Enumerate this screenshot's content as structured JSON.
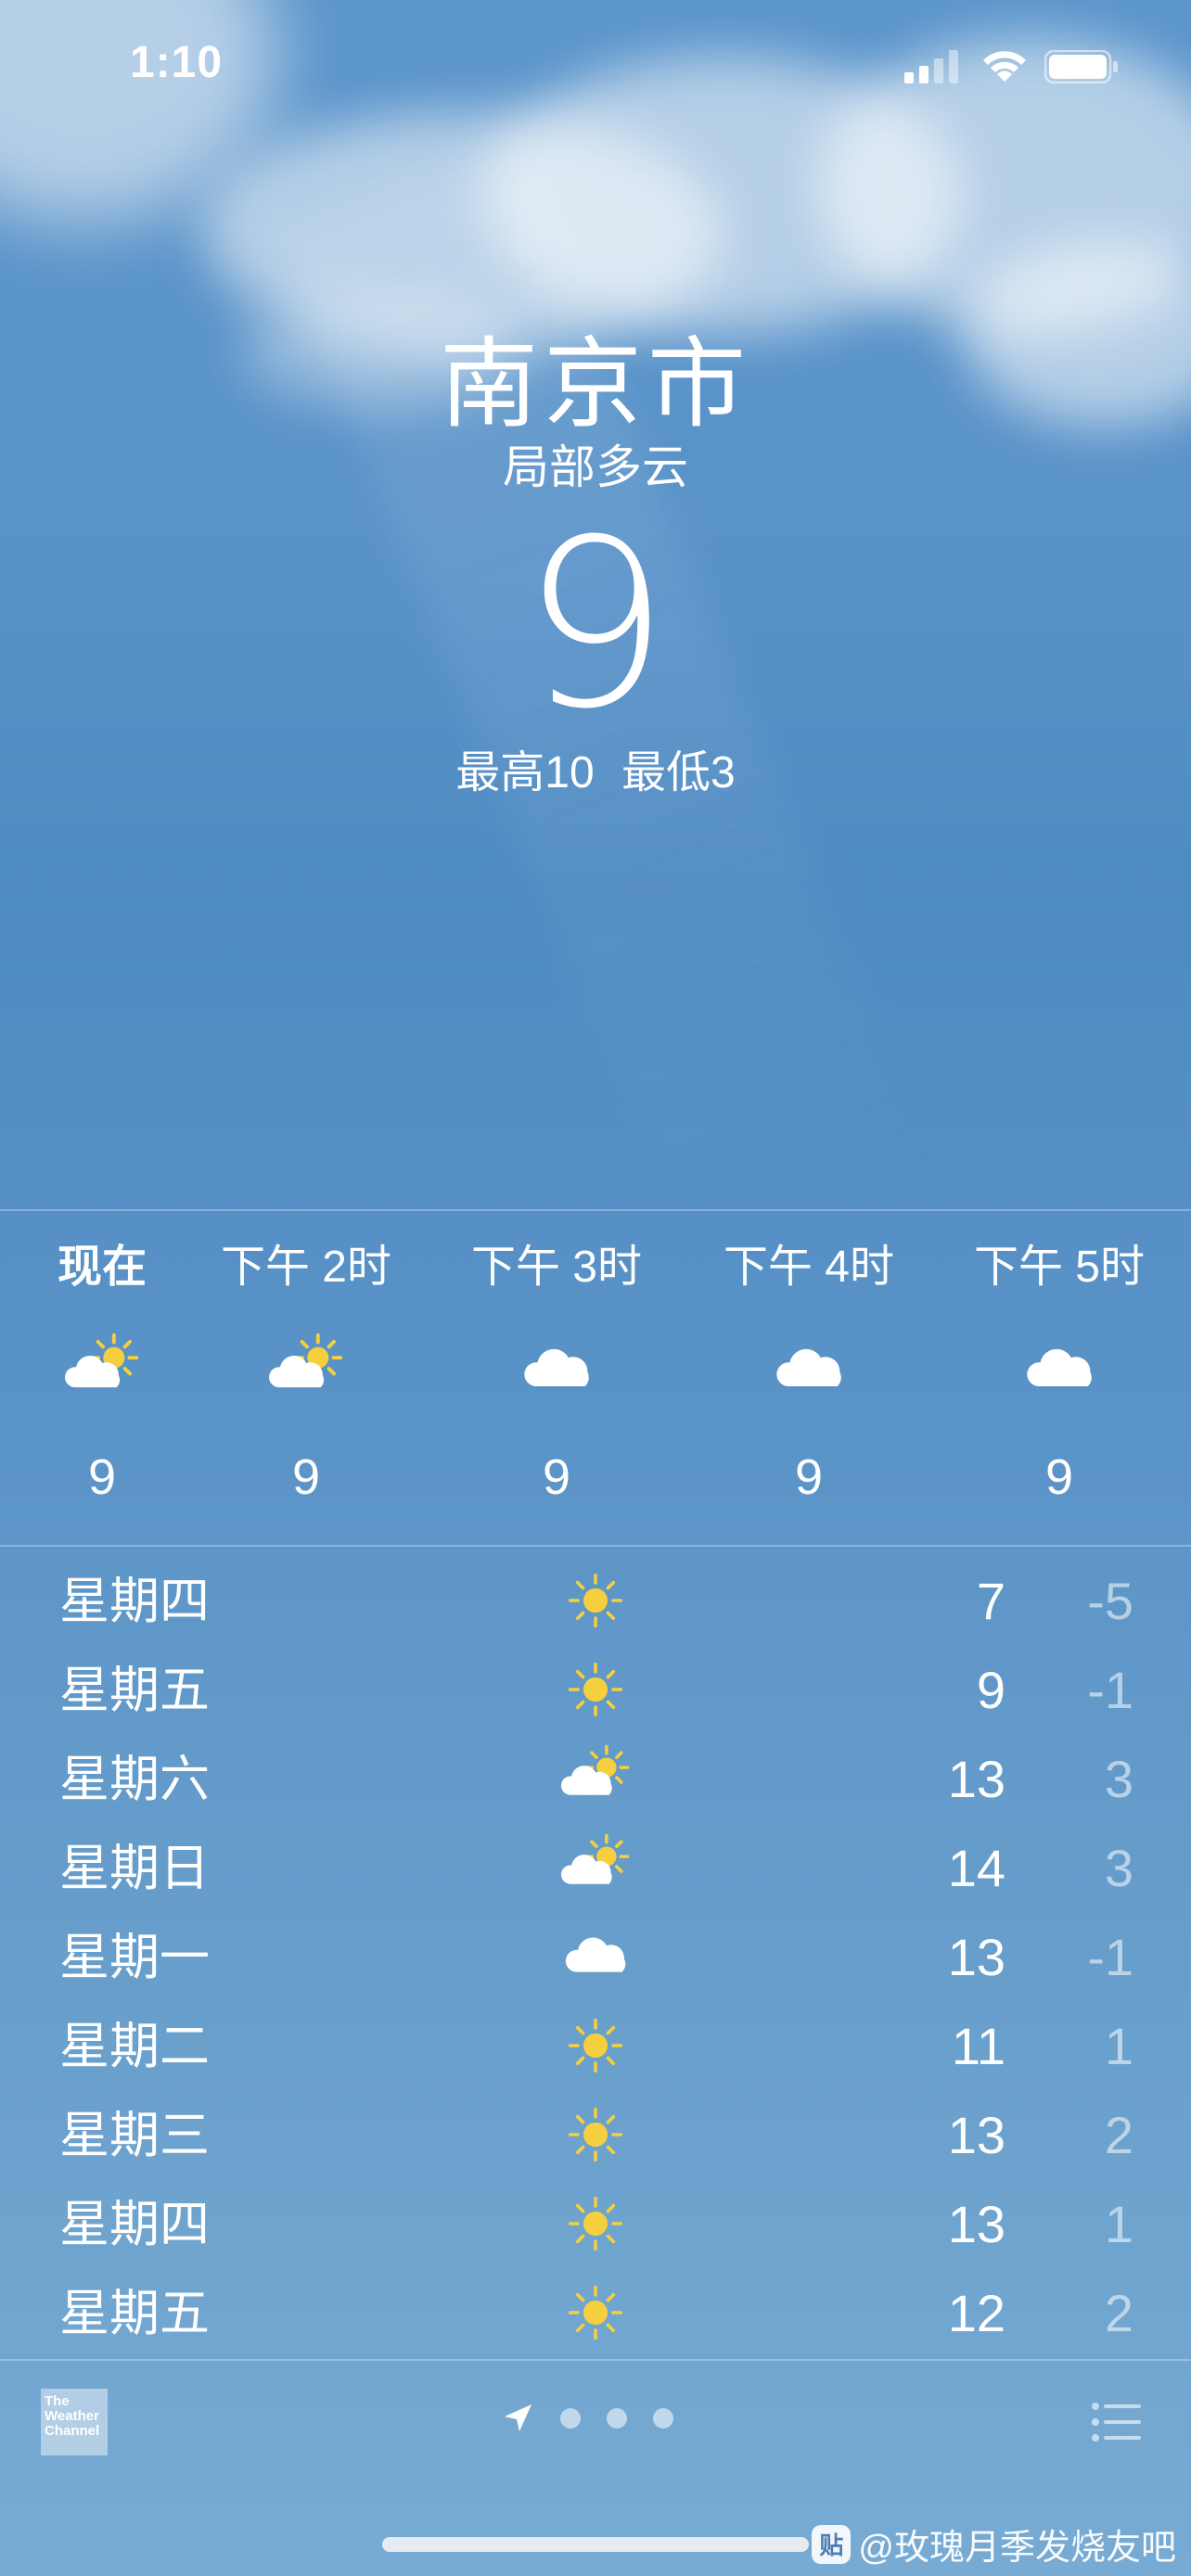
{
  "status_bar": {
    "time": "1:10"
  },
  "location": {
    "city": "南京市",
    "condition": "局部多云",
    "temperature": "9",
    "high_label": "最高10",
    "low_label": "最低3"
  },
  "hourly": [
    {
      "label": "现在",
      "icon": "sun-behind-cloud-icon",
      "temp": "9"
    },
    {
      "label": "下午 2时",
      "icon": "sun-behind-cloud-icon",
      "temp": "9"
    },
    {
      "label": "下午 3时",
      "icon": "cloud-icon",
      "temp": "9"
    },
    {
      "label": "下午 4时",
      "icon": "cloud-icon",
      "temp": "9"
    },
    {
      "label": "下午 5时",
      "icon": "cloud-icon",
      "temp": "9"
    }
  ],
  "daily": [
    {
      "day": "星期四",
      "icon": "sun-icon",
      "high": "7",
      "low": "-5"
    },
    {
      "day": "星期五",
      "icon": "sun-icon",
      "high": "9",
      "low": "-1"
    },
    {
      "day": "星期六",
      "icon": "sun-behind-cloud-icon",
      "high": "13",
      "low": "3"
    },
    {
      "day": "星期日",
      "icon": "sun-behind-cloud-icon",
      "high": "14",
      "low": "3"
    },
    {
      "day": "星期一",
      "icon": "cloud-icon",
      "high": "13",
      "low": "-1"
    },
    {
      "day": "星期二",
      "icon": "sun-icon",
      "high": "11",
      "low": "1"
    },
    {
      "day": "星期三",
      "icon": "sun-icon",
      "high": "13",
      "low": "2"
    },
    {
      "day": "星期四",
      "icon": "sun-icon",
      "high": "13",
      "low": "1"
    },
    {
      "day": "星期五",
      "icon": "sun-icon",
      "high": "12",
      "low": "2"
    }
  ],
  "footer": {
    "weather_channel_logo": "The Weather Channel",
    "page_dots": 3
  },
  "watermark": {
    "badge": "贴",
    "text": "@玫瑰月季发烧友吧"
  },
  "colors": {
    "sun": "#f6cf3f",
    "cloud": "#ffffff",
    "low_temp": "rgba(255,255,255,0.55)"
  }
}
